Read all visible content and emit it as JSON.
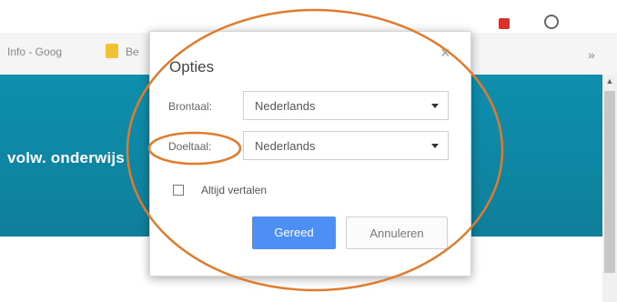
{
  "browser": {
    "bookmarks": [
      {
        "label": "Info - Goog"
      },
      {
        "label": "Be"
      }
    ]
  },
  "page": {
    "header_text": "volw. onderwijs"
  },
  "dialog": {
    "title": "Opties",
    "close_symbol": "×",
    "source_label": "Brontaal:",
    "source_value": "Nederlands",
    "target_label": "Doeltaal:",
    "target_value": "Nederlands",
    "always_translate_label": "Altijd vertalen",
    "always_translate_checked": false,
    "done_button": "Gereed",
    "cancel_button": "Annuleren"
  },
  "annotations": {
    "color": "#e07b2e"
  },
  "colors": {
    "header_teal": "#0f8aa8",
    "primary_button": "#4d8ff4"
  }
}
